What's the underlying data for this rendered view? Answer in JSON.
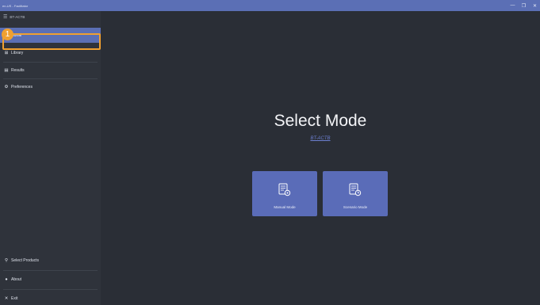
{
  "window": {
    "title": "en-US - Facilitator",
    "minimize_glyph": "—",
    "maximize_glyph": "❐",
    "close_glyph": "✕"
  },
  "app": {
    "name": "BT-ACTB",
    "menu_glyph": "☰"
  },
  "sidebar": {
    "items": [
      {
        "label": "Home",
        "icon": "home-icon",
        "glyph": "⌂",
        "active": true
      },
      {
        "label": "Library",
        "icon": "library-icon",
        "glyph": "⊞",
        "active": false
      },
      {
        "label": "Results",
        "icon": "results-icon",
        "glyph": "▤",
        "active": false
      },
      {
        "label": "Preferences",
        "icon": "gear-icon",
        "glyph": "⚙",
        "active": false
      }
    ],
    "bottom_items": [
      {
        "label": "Select Products",
        "icon": "select-products-icon",
        "glyph": "⚲"
      },
      {
        "label": "About",
        "icon": "info-icon",
        "glyph": "●"
      },
      {
        "label": "Exit",
        "icon": "close-icon",
        "glyph": "✕"
      }
    ]
  },
  "annotation": {
    "number": "1",
    "target": "Library"
  },
  "main": {
    "heading": "Select Mode",
    "subtitle": "BT-ACTB",
    "modes": [
      {
        "label": "Manual Mode",
        "icon": "manual-mode-icon"
      },
      {
        "label": "Scenario Mode",
        "icon": "scenario-mode-icon"
      }
    ]
  },
  "colors": {
    "accent": "#5b6fb5",
    "sidebar_bg": "#2f333b",
    "main_bg": "#2a2e36",
    "highlight": "#f0a030",
    "link": "#6c7fd0"
  }
}
